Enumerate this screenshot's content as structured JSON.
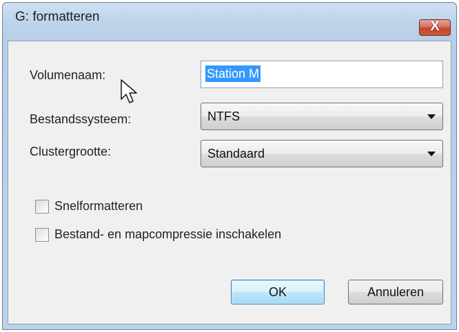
{
  "window": {
    "title": "G: formatteren",
    "close_label": "X"
  },
  "form": {
    "volume_label": "Volumenaam:",
    "volume_value": "Station M",
    "filesystem_label": "Bestandssysteem:",
    "filesystem_value": "NTFS",
    "cluster_label": "Clustergrootte:",
    "cluster_value": "Standaard"
  },
  "options": {
    "quick_format_label": "Snelformatteren",
    "quick_format_checked": false,
    "compression_label": "Bestand- en mapcompressie inschakelen",
    "compression_checked": false
  },
  "buttons": {
    "ok_label": "OK",
    "cancel_label": "Annuleren"
  }
}
